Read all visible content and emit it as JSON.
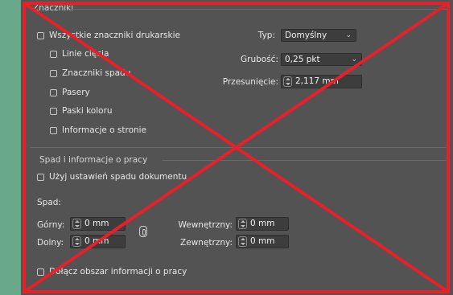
{
  "marks_section": {
    "heading": "Znaczniki",
    "all_printer_marks": "Wszystkie znaczniki drukarskie",
    "crop_marks": "Linie cięcia",
    "bleed_marks": "Znaczniki spadu",
    "registration_marks": "Pasery",
    "color_bars": "Paski koloru",
    "page_information": "Informacje o stronie",
    "type_label": "Typ:",
    "type_value": "Domyślny",
    "weight_label": "Grubość:",
    "weight_value": "0,25 pkt",
    "offset_label": "Przesunięcie:",
    "offset_value": "2,117 mm"
  },
  "bleed_section": {
    "heading": "Spad i informacje o pracy",
    "use_document_bleed": "Użyj ustawień spadu dokumentu",
    "bleed_label": "Spad:",
    "top_label": "Górny:",
    "top_value": "0 mm",
    "bottom_label": "Dolny:",
    "bottom_value": "0 mm",
    "inside_label": "Wewnętrzny:",
    "inside_value": "0 mm",
    "outside_label": "Zewnętrzny:",
    "outside_value": "0 mm",
    "include_slug": "Dołącz obszar informacji o pracy"
  },
  "colors": {
    "panel_bg": "#535353",
    "side_strip": "#6aa88a",
    "cross_out": "#e8202a"
  },
  "icons": {
    "dropdown": "chevron-down-icon",
    "spinner": "stepper-icon",
    "link": "chain-link-icon"
  }
}
